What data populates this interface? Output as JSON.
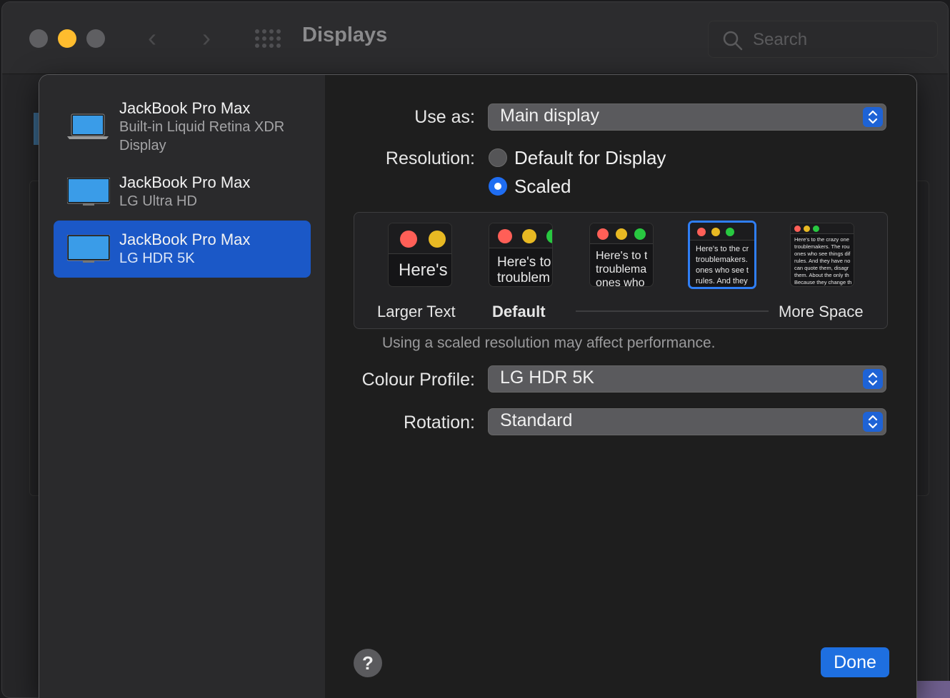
{
  "window": {
    "title": "Displays",
    "search_placeholder": "Search"
  },
  "sidebar": {
    "items": [
      {
        "name": "JackBook Pro Max",
        "sub": "Built-in Liquid Retina XDR Display",
        "icon": "laptop-icon",
        "selected": false
      },
      {
        "name": "JackBook Pro Max",
        "sub": "LG Ultra HD",
        "icon": "monitor-icon",
        "selected": false
      },
      {
        "name": "JackBook Pro Max",
        "sub": "LG HDR 5K",
        "icon": "monitor-icon",
        "selected": true
      }
    ]
  },
  "settings": {
    "use_as_label": "Use as:",
    "use_as_value": "Main display",
    "resolution_label": "Resolution:",
    "resolution_options": [
      "Default for Display",
      "Scaled"
    ],
    "resolution_selected": "Scaled",
    "scale_thumbs": [
      {
        "text": "Here's"
      },
      {
        "text": "Here's to\ntroublem"
      },
      {
        "text": "Here's to t\ntroublema\nones who"
      },
      {
        "text": "Here's to the cr\ntroublemakers.\nones who see t\nrules. And they"
      },
      {
        "text": "Here's to the crazy one\ntroublemakers. The rou\nones who see things dif\nrules. And they have no\ncan quote them, disagr\nthem. About the only th\nBecause they change th"
      }
    ],
    "scale_selected_index": 3,
    "scale_labels": {
      "left": "Larger Text",
      "default": "Default",
      "right": "More Space"
    },
    "performance_note": "Using a scaled resolution may affect performance.",
    "colour_profile_label": "Colour Profile:",
    "colour_profile_value": "LG HDR 5K",
    "rotation_label": "Rotation:",
    "rotation_value": "Standard"
  },
  "footer": {
    "help_label": "?",
    "done_label": "Done"
  },
  "colors": {
    "accent": "#1e6fe0",
    "selection": "#1b58c7",
    "traffic_red": "#ff5f57",
    "traffic_yellow": "#febc2e",
    "traffic_green": "#28c840"
  }
}
